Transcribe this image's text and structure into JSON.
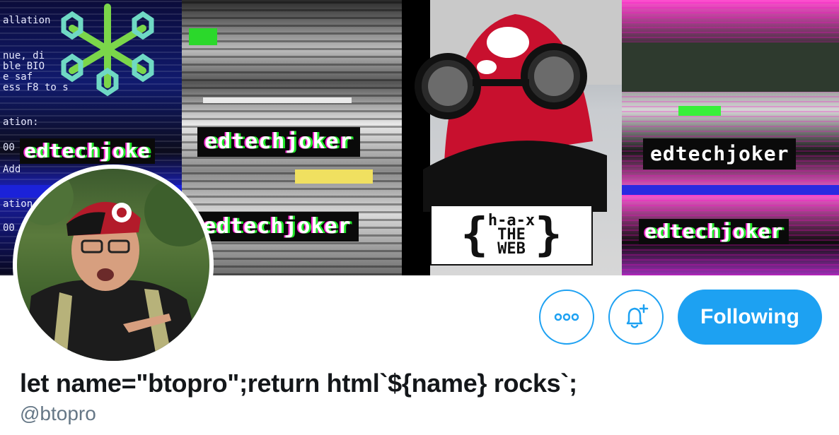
{
  "banner": {
    "tags": [
      "edtechjoke",
      "edtechjoker",
      "edtechjoker",
      "edtechjoker",
      "edtechjoker"
    ],
    "hax_sign": {
      "line1": "h-a-x",
      "line2": "THE",
      "line3": "WEB"
    },
    "terminal_lines": [
      "allation",
      "nue, di",
      "ble BIO",
      "e saf",
      "ess F8 to s",
      "ation:",
      "00",
      "Add",
      "ation",
      "00"
    ]
  },
  "avatar": {
    "alt": "btopro profile photo"
  },
  "actions": {
    "more_icon": "more-horizontal-icon",
    "notify_icon": "bell-plus-icon",
    "following_label": "Following"
  },
  "profile": {
    "display_name": "let name=\"btopro\";return html`${name} rocks`;",
    "handle": "@btopro"
  },
  "colors": {
    "accent": "#1da1f2",
    "name": "#14171a",
    "handle": "#657786"
  }
}
